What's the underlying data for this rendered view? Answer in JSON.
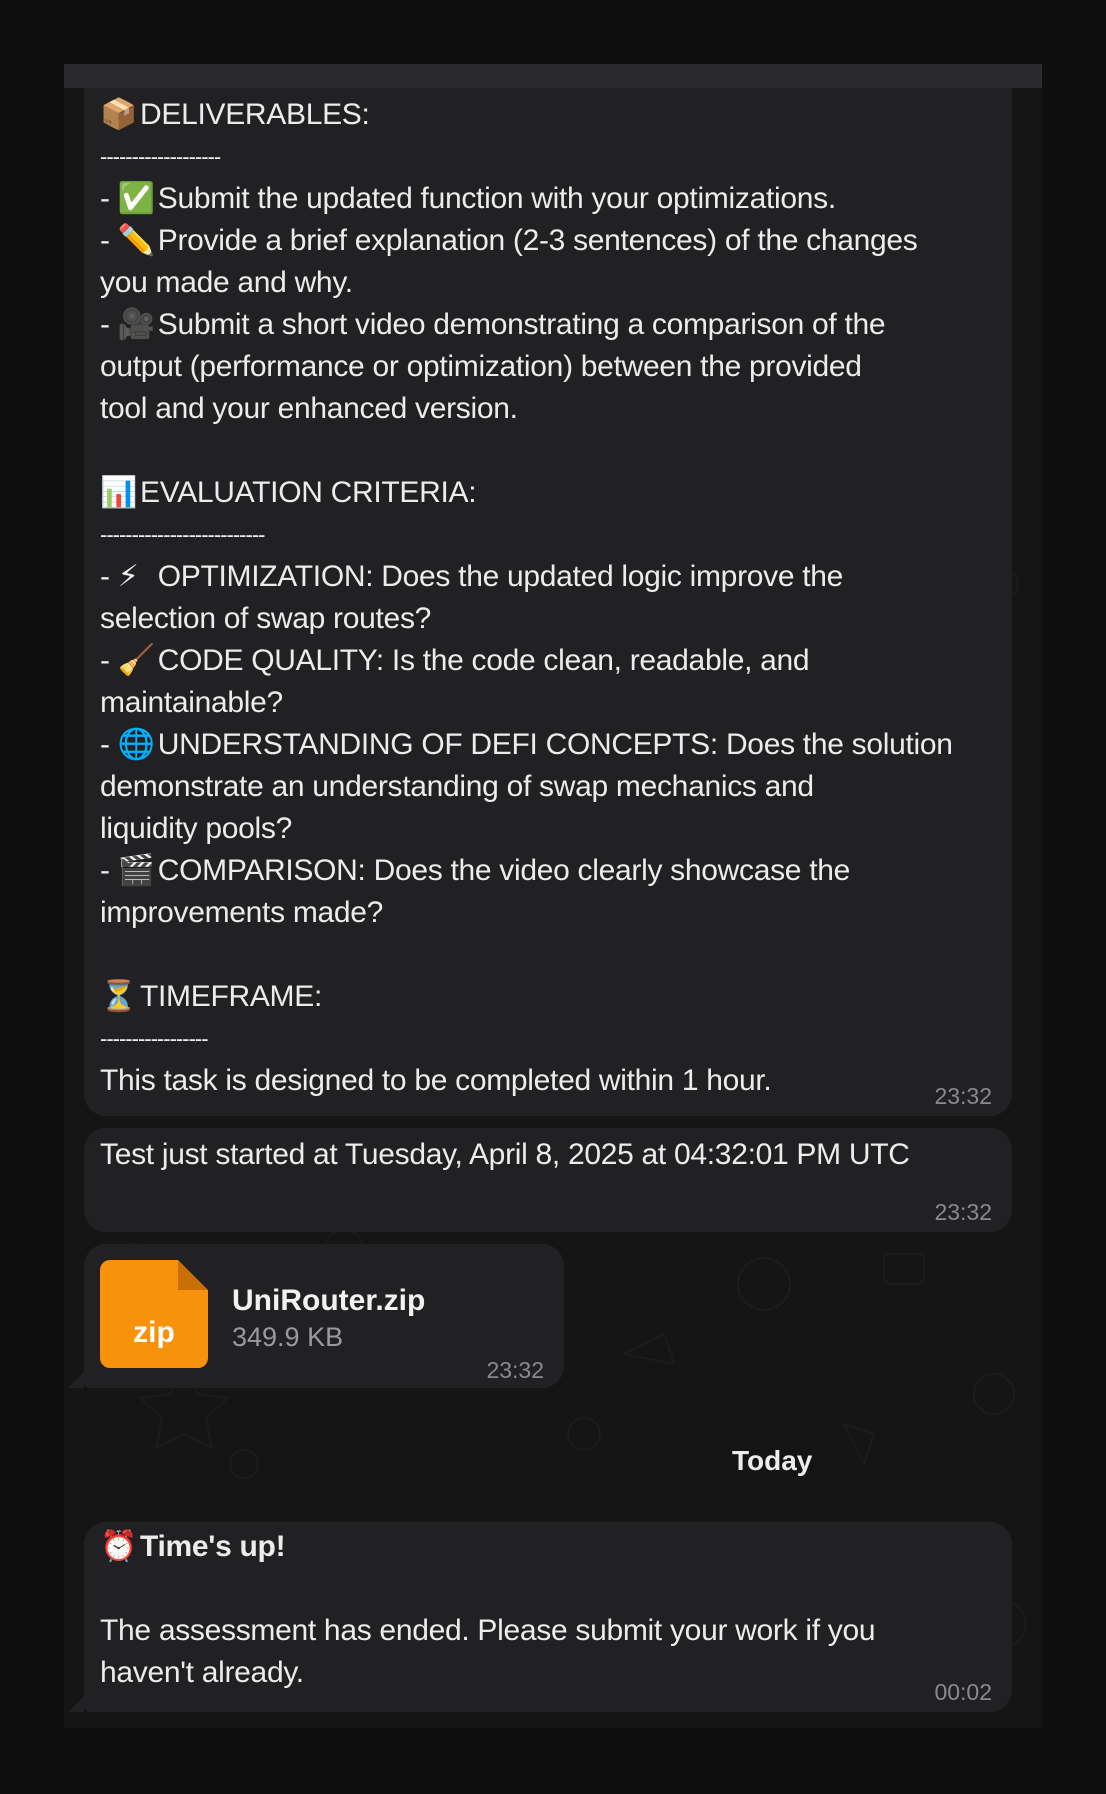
{
  "messages": {
    "deliverables": {
      "header_emoji": "📦",
      "header": "DELIVERABLES:",
      "divider": "-------------------",
      "items": [
        {
          "emoji": "✅",
          "text": "Submit the updated function with your optimizations."
        },
        {
          "emoji": "✏️",
          "text": "Provide a brief explanation (2-3 sentences) of the changes",
          "cont": [
            "you made and why."
          ]
        },
        {
          "emoji": "🎥",
          "text": "Submit a short video demonstrating a comparison of the",
          "cont": [
            "output (performance or optimization) between the provided",
            "tool and your enhanced version."
          ]
        }
      ]
    },
    "criteria": {
      "header_emoji": "📊",
      "header": "EVALUATION CRITERIA:",
      "divider": "--------------------------",
      "items": [
        {
          "emoji": "⚡",
          "text": "OPTIMIZATION: Does the updated logic improve the",
          "cont": [
            "selection of swap routes?"
          ]
        },
        {
          "emoji": "🧹",
          "text": "CODE QUALITY: Is the code clean, readable, and",
          "cont": [
            "maintainable?"
          ]
        },
        {
          "emoji": "🌐",
          "text": "UNDERSTANDING OF DEFI CONCEPTS: Does the solution",
          "cont": [
            "demonstrate an understanding of swap mechanics and",
            "liquidity pools?"
          ]
        },
        {
          "emoji": "🎬",
          "text": "COMPARISON: Does the video clearly showcase the",
          "cont": [
            "improvements made?"
          ]
        }
      ]
    },
    "timeframe": {
      "header_emoji": "⏳",
      "header": "TIMEFRAME:",
      "divider": "-----------------",
      "text": "This task is designed to be completed within 1 hour.",
      "time": "23:32"
    },
    "test_started": {
      "text": "Test just started at Tuesday, April 8, 2025 at 04:32:01 PM UTC",
      "time": "23:32"
    },
    "file": {
      "icon_label": "zip",
      "name": "UniRouter.zip",
      "size": "349.9 KB",
      "time": "23:32"
    },
    "day_separator": "Today",
    "times_up": {
      "emoji": "⏰",
      "title": "Time's up!",
      "line1": "The assessment has ended. Please submit your work if you",
      "line2": "haven't already.",
      "time": "00:02"
    }
  },
  "colors": {
    "background": "#0f0f10",
    "bubble": "#212123",
    "file_icon": "#f8910b"
  }
}
